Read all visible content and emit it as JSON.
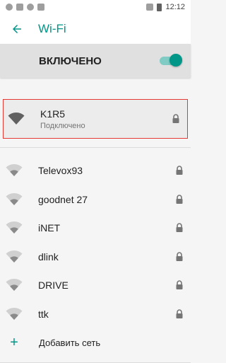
{
  "statusbar": {
    "time": "12:12"
  },
  "appbar": {
    "title": "Wi-Fi"
  },
  "master": {
    "label": "ВКЛЮЧЕНО",
    "enabled": true
  },
  "connected": {
    "name": "K1R5",
    "status": "Подключено",
    "secured": true,
    "icon": "wifi-full-icon"
  },
  "networks": [
    {
      "name": "Televox93",
      "secured": true
    },
    {
      "name": "goodnet 27",
      "secured": true
    },
    {
      "name": "iNET",
      "secured": true
    },
    {
      "name": "dlink",
      "secured": true
    },
    {
      "name": "DRIVE",
      "secured": true
    },
    {
      "name": "ttk",
      "secured": true
    }
  ],
  "add_network": {
    "label": "Добавить сеть"
  },
  "colors": {
    "accent": "#009688",
    "highlight_border": "#e53935"
  }
}
